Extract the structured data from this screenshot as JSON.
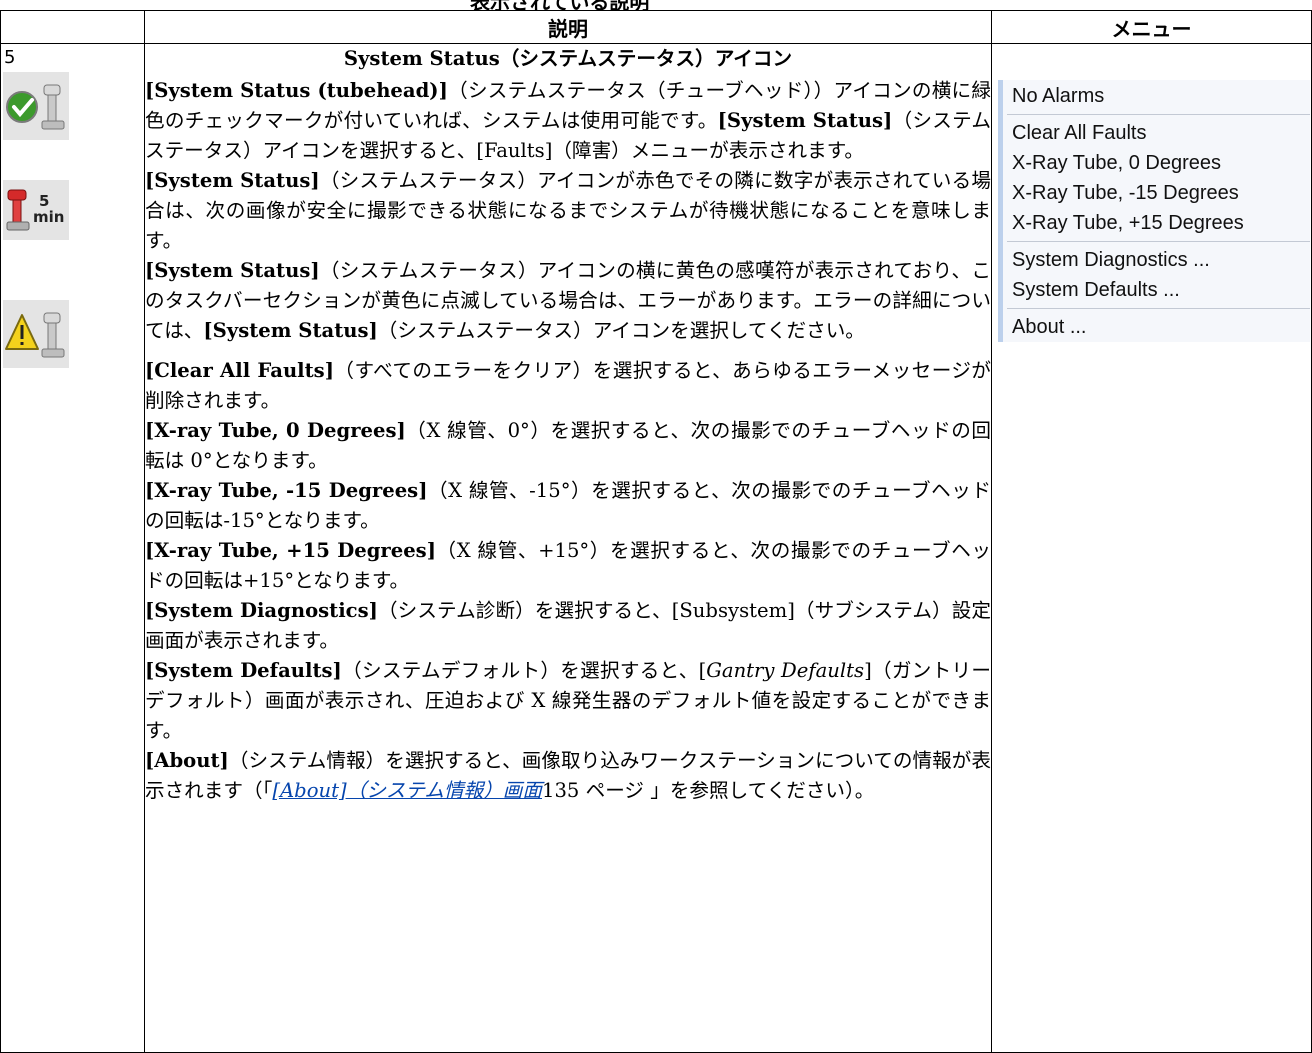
{
  "page_header_cropped": "表示されている説明",
  "table": {
    "headers": {
      "col1": "",
      "col2": "説明",
      "col3": "メニュー"
    },
    "row_number": "5",
    "icons": {
      "ok": "green-check-tubehead-icon",
      "wait": "red-tubehead-5min-icon",
      "wait_label": "5\nmin",
      "warning": "yellow-exclamation-tubehead-icon"
    },
    "title": "System Status（システムステータス）アイコン",
    "paragraphs": [
      {
        "b1": "[System Status (tubehead)]",
        "t1": "（システムステータス（チューブヘッド））アイコンの横に緑色のチェックマークが付いていれば、システムは使用可能です。",
        "b2": "[System Status]",
        "t2": "（システムステータス）アイコンを選択すると、[Faults]（障害）メニューが表示されます。"
      },
      {
        "b1": "[System Status]",
        "t1": "（システムステータス）アイコンが赤色でその隣に数字が表示されている場合は、次の画像が安全に撮影できる状態になるまでシステムが待機状態になることを意味します。"
      },
      {
        "b1": "[System Status]",
        "t1": "（システムステータス）アイコンの横に黄色の感嘆符が表示されており、このタスクバーセクションが黄色に点滅している場合は、エラーがあります。エラーの詳細については、",
        "b2": "[System Status]",
        "t2": "（システムステータス）アイコンを選択してください。"
      },
      {
        "b1": "[Clear All Faults]",
        "t1": "（すべてのエラーをクリア）を選択すると、あらゆるエラーメッセージが削除されます。"
      },
      {
        "b1": "[X-ray Tube, 0 Degrees]",
        "t1": "（X 線管、0°）を選択すると、次の撮影でのチューブヘッドの回転は 0°となります。"
      },
      {
        "b1": "[X-ray Tube, -15 Degrees]",
        "t1": "（X 線管、-15°）を選択すると、次の撮影でのチューブヘッドの回転は-15°となります。"
      },
      {
        "b1": "[X-ray Tube, +15 Degrees]",
        "t1": "（X 線管、+15°）を選択すると、次の撮影でのチューブヘッドの回転は+15°となります。"
      },
      {
        "b1": "[System Diagnostics]",
        "t1": "（システム診断）を選択すると、[Subsystem]（サブシステム）設定画面が表示されます。"
      },
      {
        "b1": "[System Defaults]",
        "t1": "（システムデフォルト）を選択すると、[",
        "i1": "Gantry Defaults",
        "t2": "]（ガントリーデフォルト）画面が表示され、圧迫および X 線発生器のデフォルト値を設定することができます。"
      },
      {
        "b1": "[About]",
        "t1": "（システム情報）を選択すると、画像取り込みワークステーションについての情報が表示されます（「",
        "link": "[About]（システム情報）画面",
        "t2": "135 ページ 」を参照してください）。"
      }
    ]
  },
  "menu": {
    "groups": [
      [
        "No Alarms"
      ],
      [
        "Clear All Faults",
        "X-Ray Tube, 0 Degrees",
        "X-Ray Tube, -15 Degrees",
        "X-Ray Tube, +15 Degrees"
      ],
      [
        "System Diagnostics ...",
        "System Defaults ..."
      ],
      [
        "About ..."
      ]
    ]
  }
}
